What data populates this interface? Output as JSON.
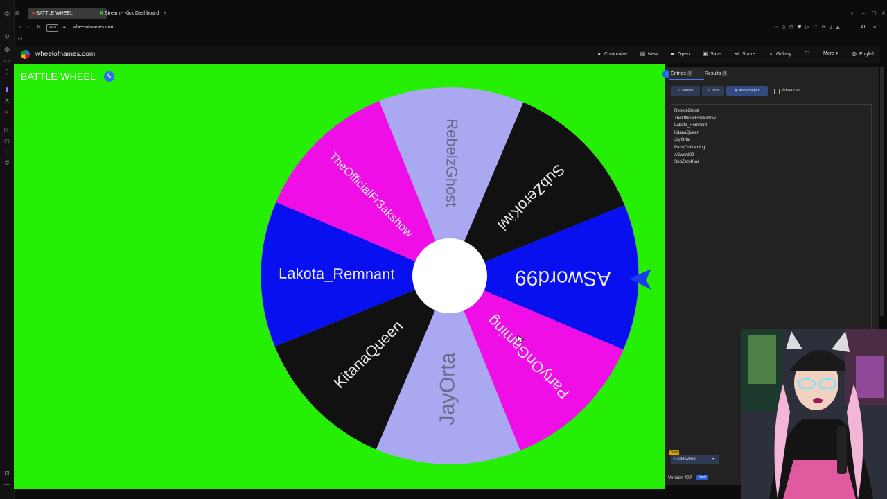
{
  "browser": {
    "tabs": [
      {
        "title": "BATTLE WHEEL",
        "active": true
      },
      {
        "title": "Stream - Kick Dashboard",
        "active": false
      }
    ],
    "new_tab": "+",
    "vpn": "VPN",
    "url": "wheelofnames.com",
    "ai_label": "AI"
  },
  "header": {
    "brand": "wheelofnames.com",
    "buttons": [
      {
        "label": "Customize",
        "icon": "palette-icon"
      },
      {
        "label": "New",
        "icon": "file-icon"
      },
      {
        "label": "Open",
        "icon": "folder-icon"
      },
      {
        "label": "Save",
        "icon": "save-icon"
      },
      {
        "label": "Share",
        "icon": "share-icon"
      },
      {
        "label": "Gallery",
        "icon": "search-icon"
      },
      {
        "label": "",
        "icon": "fullscreen-icon"
      },
      {
        "label": "More",
        "icon": "chevron-down-icon"
      },
      {
        "label": "English",
        "icon": "globe-icon"
      }
    ]
  },
  "wheel": {
    "title": "BATTLE WHEEL",
    "edit_icon": "pencil-icon",
    "segments": [
      {
        "name": "RebelzGhost",
        "color": "#aaa8f0"
      },
      {
        "name": "SubZeroKiwi",
        "color": "#111111"
      },
      {
        "name": "ASword99",
        "color": "#0810f0"
      },
      {
        "name": "PartyOnGaming",
        "color": "#ef0ee6"
      },
      {
        "name": "JayOrta",
        "color": "#aaa8f0"
      },
      {
        "name": "KitanaQueen",
        "color": "#111111"
      },
      {
        "name": "Lakota_Remnant",
        "color": "#0810f0"
      },
      {
        "name": "TheOfficialFr3akshow",
        "color": "#ef0ee6"
      }
    ],
    "pointer_color": "#1a3cf0",
    "background_color": "#24ef04"
  },
  "panel": {
    "entries_tab": "Entries",
    "entries_count": "8",
    "results_tab": "Results",
    "results_count": "4",
    "shuffle": "Shuffle",
    "sort": "Sort",
    "add_image": "Add image",
    "advanced": "Advanced",
    "entries": [
      "RebelzGhost",
      "TheOfficialFr3akshow",
      "Lakota_Remnant",
      "KitanaQueen",
      "JayOrta",
      "PartyOnGaming",
      "ASword99",
      "SubZeroKiwi"
    ],
    "beta": "Beta",
    "add_wheel": "Add wheel",
    "version": "Version 407",
    "new_badge": "New!"
  }
}
